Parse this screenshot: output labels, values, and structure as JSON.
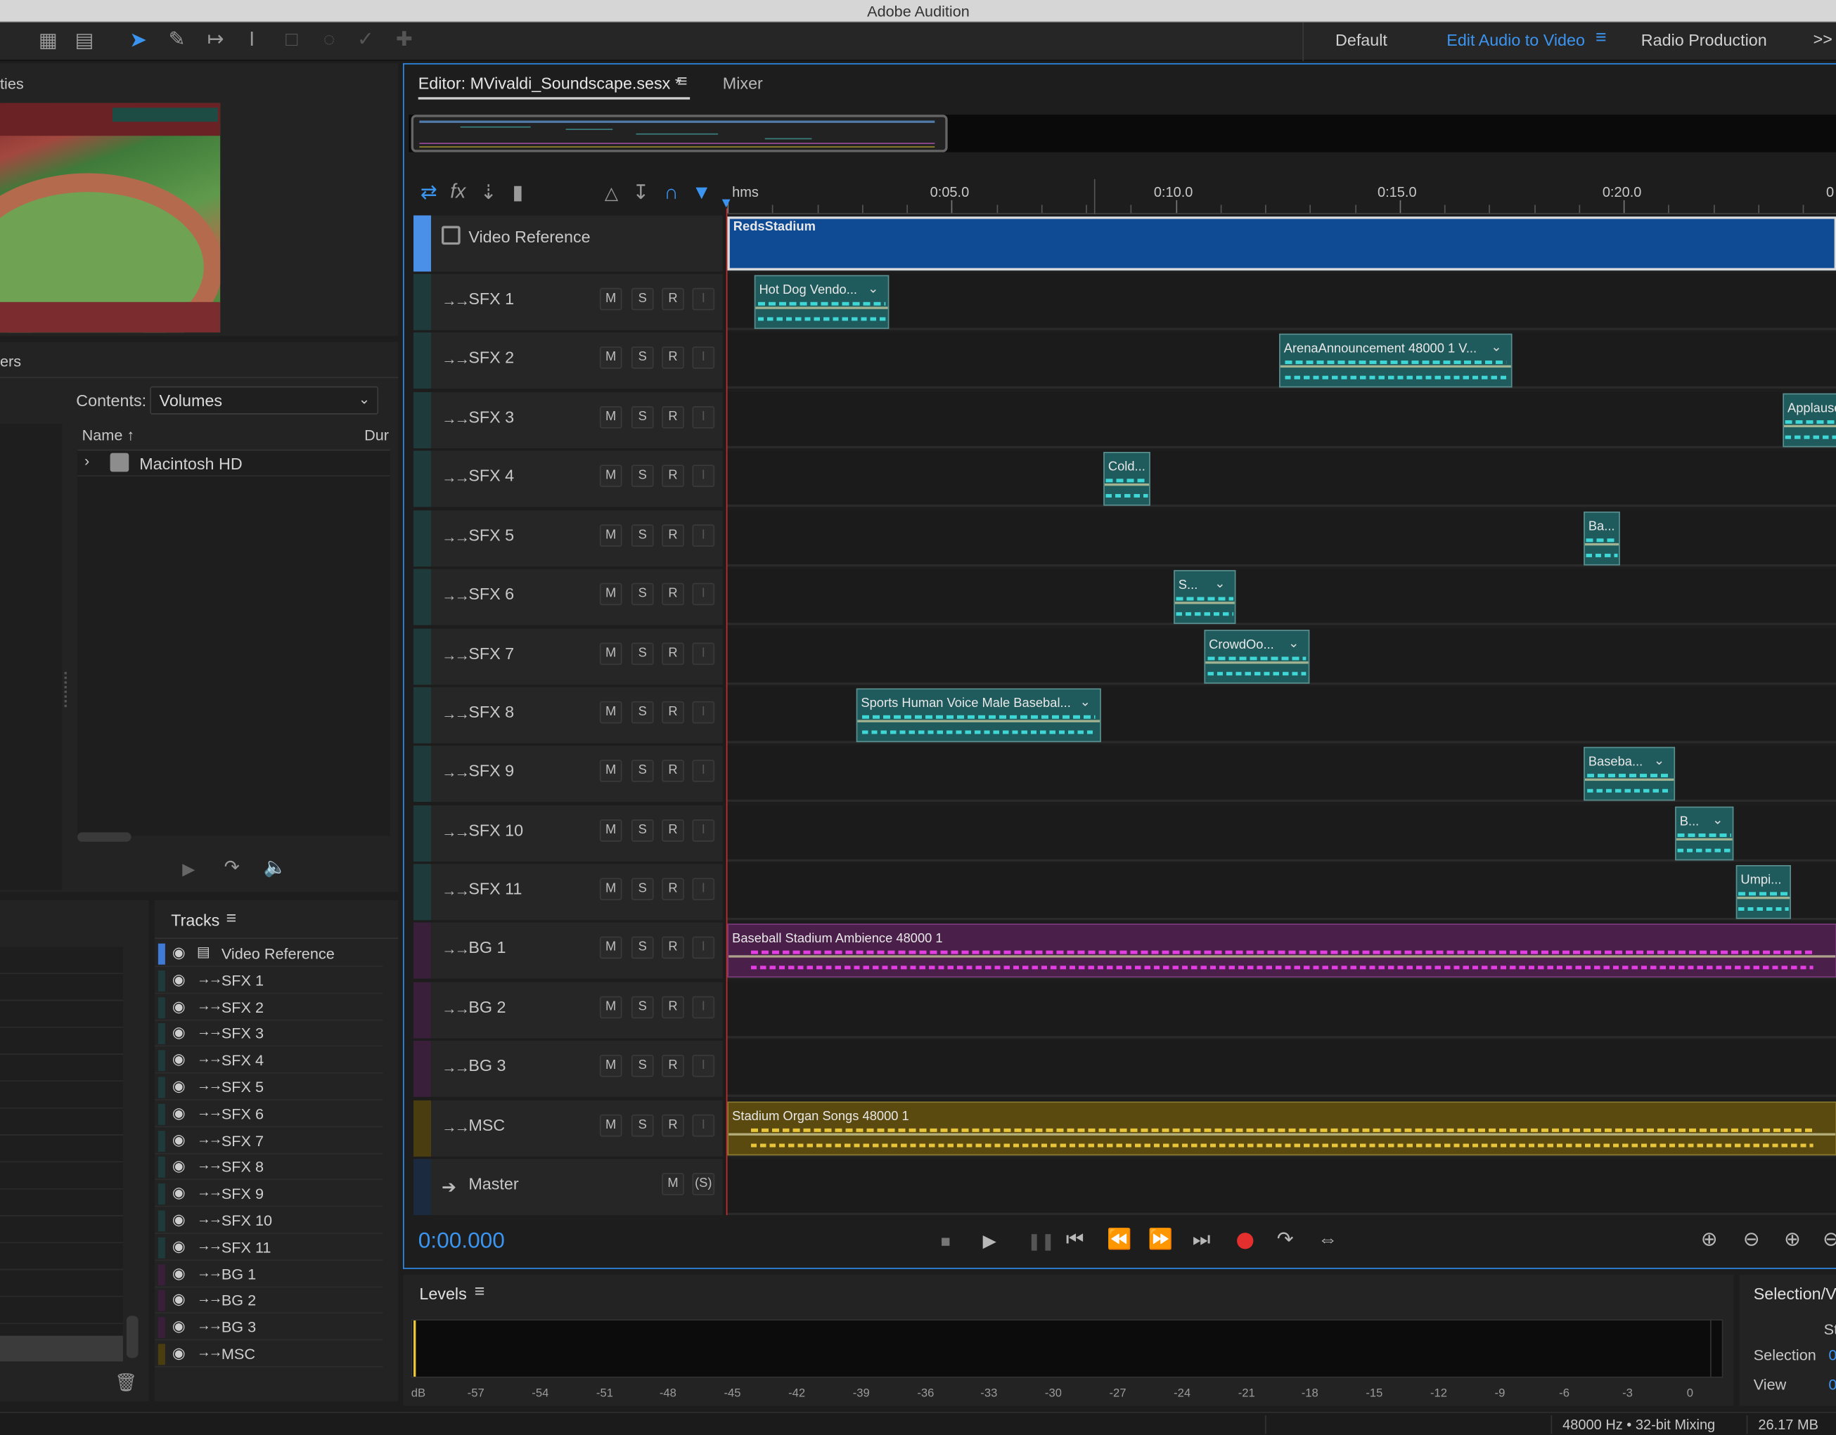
{
  "app": {
    "title": "Adobe Audition"
  },
  "workspaces": {
    "default": "Default",
    "active": "Edit Audio to Video",
    "radio": "Radio Production",
    "more": ">>"
  },
  "properties_panel": {
    "label": "ties"
  },
  "files_panel": {
    "label": "ers",
    "contents_label": "Contents:",
    "contents_value": "Volumes",
    "col_name": "Name",
    "col_dur": "Dur",
    "item": "Macintosh HD"
  },
  "editor": {
    "tab_label": "Editor: MVivaldi_Soundscape.sesx *",
    "mixer_tab": "Mixer",
    "ruler_unit": "hms",
    "ruler_labels": [
      "0:05.0",
      "0:10.0",
      "0:15.0",
      "0:20.0",
      "0"
    ]
  },
  "tracks": [
    {
      "name": "Video Reference",
      "kind": "video",
      "color": "#3f7bd6"
    },
    {
      "name": "SFX 1",
      "kind": "sfx"
    },
    {
      "name": "SFX 2",
      "kind": "sfx"
    },
    {
      "name": "SFX 3",
      "kind": "sfx"
    },
    {
      "name": "SFX 4",
      "kind": "sfx"
    },
    {
      "name": "SFX 5",
      "kind": "sfx"
    },
    {
      "name": "SFX 6",
      "kind": "sfx"
    },
    {
      "name": "SFX 7",
      "kind": "sfx"
    },
    {
      "name": "SFX 8",
      "kind": "sfx"
    },
    {
      "name": "SFX 9",
      "kind": "sfx"
    },
    {
      "name": "SFX 10",
      "kind": "sfx"
    },
    {
      "name": "SFX 11",
      "kind": "sfx"
    },
    {
      "name": "BG 1",
      "kind": "bg"
    },
    {
      "name": "BG 2",
      "kind": "bg"
    },
    {
      "name": "BG 3",
      "kind": "bg"
    },
    {
      "name": "MSC",
      "kind": "msc"
    },
    {
      "name": "Master",
      "kind": "master"
    }
  ],
  "track_buttons": {
    "m": "M",
    "s": "S",
    "r": "R",
    "i": "I",
    "solo_master": "(S)"
  },
  "clips": {
    "video": "RedsStadium",
    "sfx1": "Hot Dog Vendo...",
    "sfx2": "ArenaAnnouncement 48000 1 V...",
    "sfx3": "Applause",
    "sfx4": "Cold...",
    "sfx5": "Ba...",
    "sfx6": "S...",
    "sfx7": "CrowdOo...",
    "sfx8": "Sports Human Voice Male Basebal...",
    "sfx9": "Baseba...",
    "sfx10": "B...",
    "sfx11": "Umpi...",
    "bg1": "Baseball Stadium Ambience 48000 1",
    "msc": "Stadium Organ Songs 48000 1"
  },
  "tracks_panel": {
    "title": "Tracks",
    "items": [
      "Video Reference",
      "SFX 1",
      "SFX 2",
      "SFX 3",
      "SFX 4",
      "SFX 5",
      "SFX 6",
      "SFX 7",
      "SFX 8",
      "SFX 9",
      "SFX 10",
      "SFX 11",
      "BG 1",
      "BG 2",
      "BG 3",
      "MSC"
    ]
  },
  "transport": {
    "time": "0:00.000"
  },
  "levels": {
    "title": "Levels",
    "scale": [
      "dB",
      "-57",
      "-54",
      "-51",
      "-48",
      "-45",
      "-42",
      "-39",
      "-36",
      "-33",
      "-30",
      "-27",
      "-24",
      "-21",
      "-18",
      "-15",
      "-12",
      "-9",
      "-6",
      "-3",
      "0"
    ]
  },
  "selection_panel": {
    "title": "Selection/Vi",
    "start_abbr": "St",
    "selection_label": "Selection",
    "selection_value": "0",
    "view_label": "View",
    "view_value": "0"
  },
  "status": {
    "format": "48000 Hz • 32-bit Mixing",
    "size": "26.17 MB"
  },
  "colors": {
    "accent": "#2d8ceb",
    "sfx_clip": "#1f5a5c",
    "sfx_wave": "#3fd6d6",
    "bg_clip": "#4a1f4a",
    "bg_wave": "#e23ee2",
    "msc_clip": "#5a4a10",
    "msc_wave": "#e8c53a",
    "video_clip": "#0f4a94",
    "playhead": "#cc2b2b",
    "record": "#e3302f"
  }
}
